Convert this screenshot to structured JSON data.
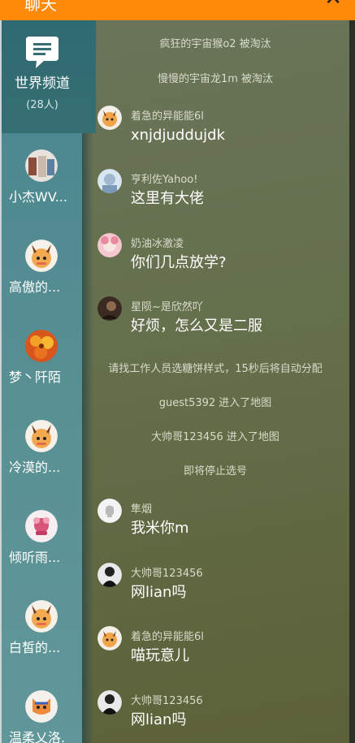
{
  "header": {
    "title": "聊天",
    "close_icon": "close-icon"
  },
  "sidebar": {
    "world": {
      "label": "世界频道",
      "count": "(28人)",
      "icon": "chat-bubble-icon"
    },
    "users": [
      {
        "name": "小杰WV...",
        "avatar": "avatar-photo"
      },
      {
        "name": "高傲的...",
        "avatar": "avatar-fox-girl"
      },
      {
        "name": "梦丶阡陌",
        "avatar": "avatar-flower"
      },
      {
        "name": "冷漠的...",
        "avatar": "avatar-fox-girl"
      },
      {
        "name": "倾听雨...",
        "avatar": "avatar-pink"
      },
      {
        "name": "白皙的...",
        "avatar": "avatar-fox-girl"
      },
      {
        "name": "温柔乂洛.",
        "avatar": "avatar-orange-cat"
      }
    ]
  },
  "chat": {
    "system": [
      "疯狂的宇宙猴o2 被淘汰",
      "慢慢的宇宙龙1m 被淘汰",
      "请找工作人员选糖饼样式，15秒后将自动分配",
      "guest5392 进入了地图",
      "大帅哥123456 进入了地图",
      "即将停止选号"
    ],
    "messages": [
      {
        "name": "着急的异能能6l",
        "text": "xnjdjuddujdk"
      },
      {
        "name": "亨利佐Yahoo!",
        "text": "这里有大佬"
      },
      {
        "name": "奶油冰激凌",
        "text": "你们几点放学?"
      },
      {
        "name": "星陨~是欣然吖",
        "text": "好烦，怎么又是二服"
      },
      {
        "name": "隼烟",
        "text": "我米你m"
      },
      {
        "name": "大帅哥123456",
        "text": "网lian吗"
      },
      {
        "name": "着急的异能能6l",
        "text": "喵玩意儿"
      },
      {
        "name": "大帅哥123456",
        "text": "网lian吗"
      }
    ]
  },
  "colors": {
    "header": "#ff8a0a",
    "world_bg": "#2f6a72",
    "users_bg": "#5a9194",
    "chat_bg": "#65704d"
  }
}
